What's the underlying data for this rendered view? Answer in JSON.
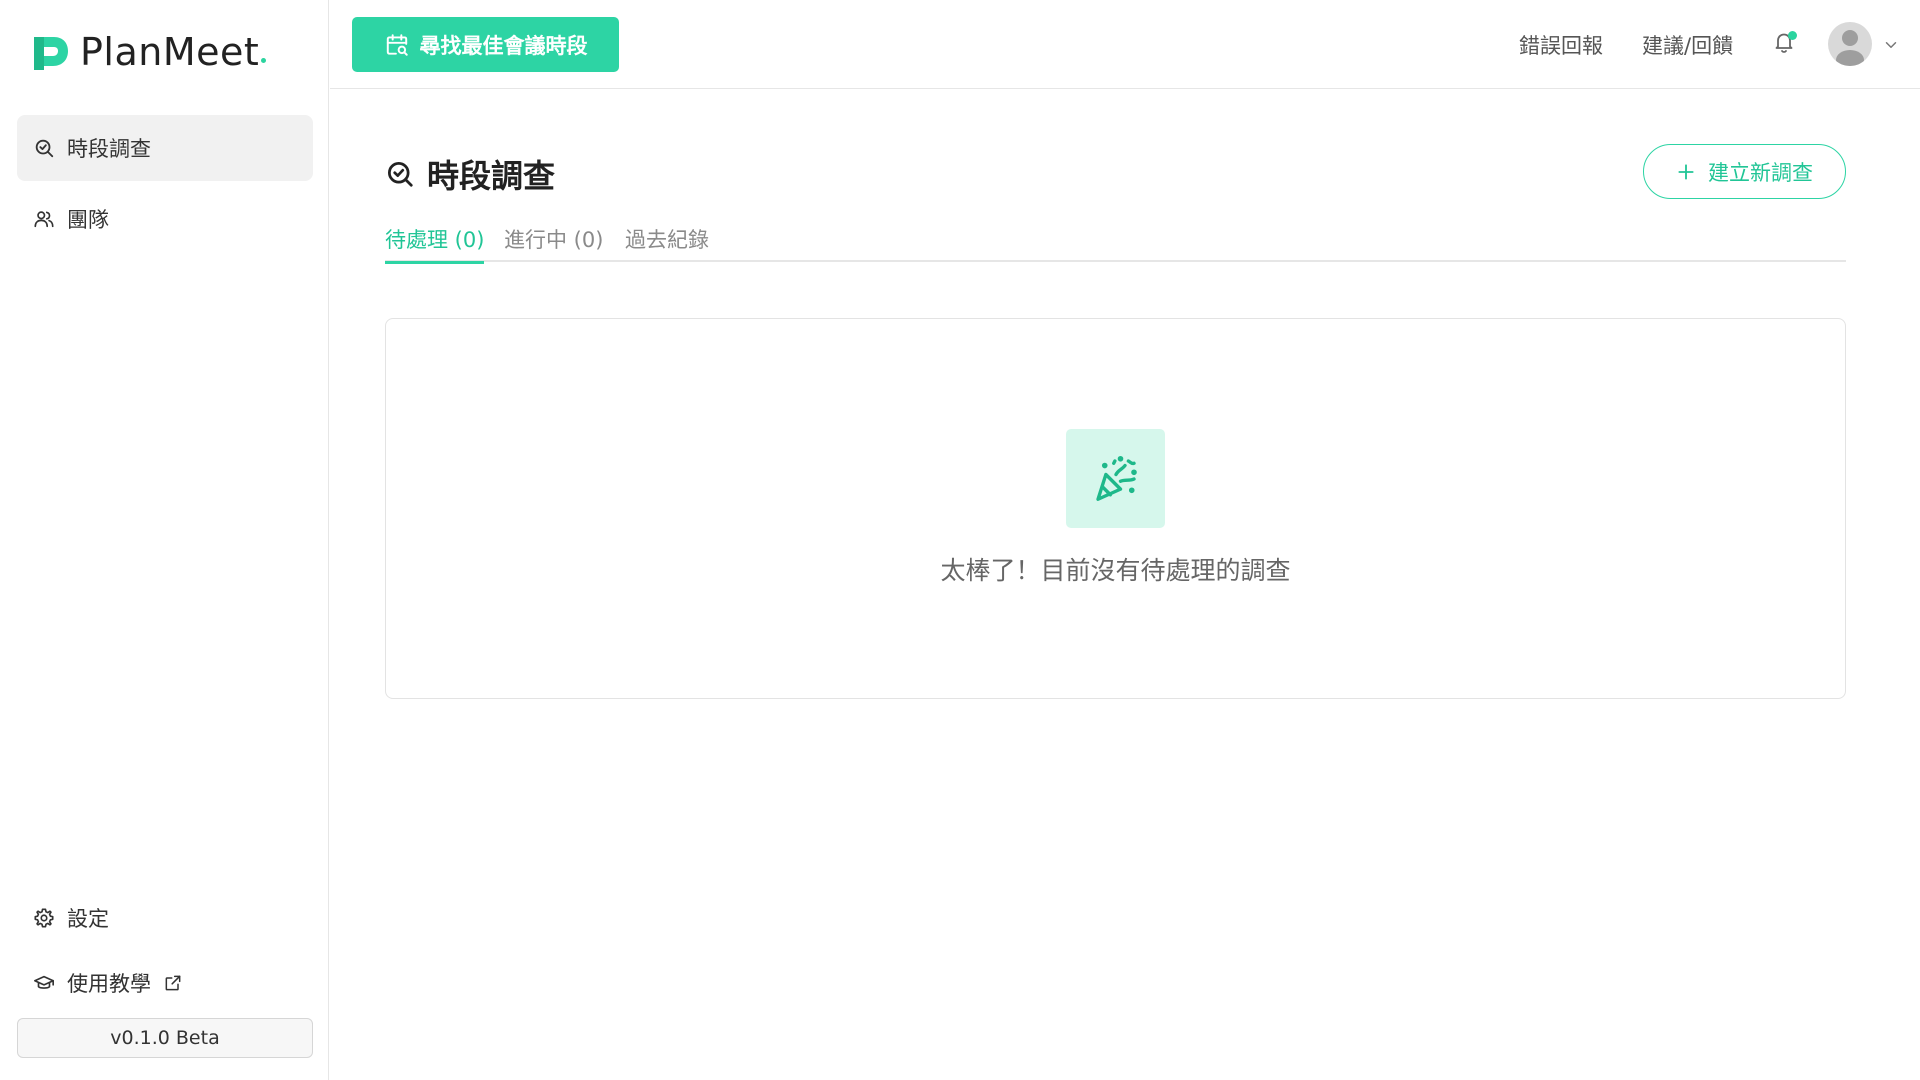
{
  "brand": {
    "name": "PlanMeet",
    "accent": "#2dd4a4"
  },
  "sidebar": {
    "items": [
      {
        "label": "時段調查",
        "icon": "search-check-icon",
        "active": true
      },
      {
        "label": "團隊",
        "icon": "users-icon",
        "active": false
      }
    ],
    "bottom": {
      "settings_label": "設定",
      "tutorial_label": "使用教學",
      "version": "v0.1.0 Beta"
    }
  },
  "topbar": {
    "find_button_label": "尋找最佳會議時段",
    "bug_report_label": "錯誤回報",
    "feedback_label": "建議/回饋"
  },
  "main": {
    "title": "時段調查",
    "new_button_label": "建立新調查",
    "tabs": [
      {
        "label": "待處理 (0)",
        "active": true
      },
      {
        "label": "進行中 (0)",
        "active": false
      },
      {
        "label": "過去紀錄",
        "active": false
      }
    ],
    "empty": {
      "icon": "party-popper-icon",
      "message": "太棒了！目前沒有待處理的調查"
    }
  }
}
